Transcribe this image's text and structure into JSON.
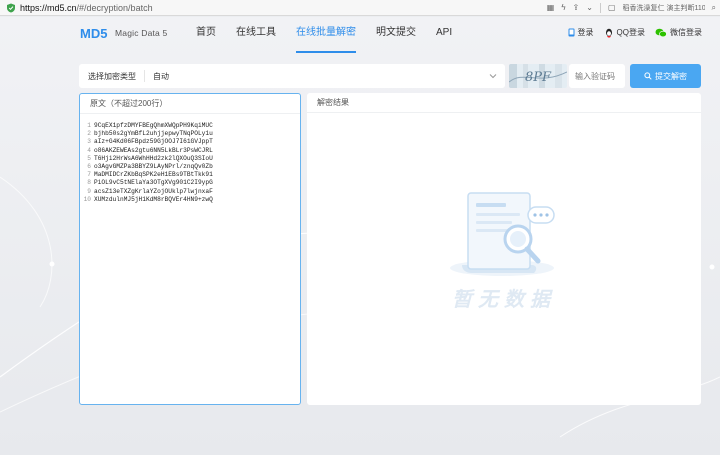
{
  "browser": {
    "url_host": "https://md5.cn",
    "url_path": "/#/decryption/batch",
    "hot_search": "稻香洗澡复仁 演主判断110万"
  },
  "nav": {
    "logo_mark": "MD5",
    "logo_text": "Magic Data 5",
    "menu": [
      {
        "label": "首页",
        "active": false
      },
      {
        "label": "在线工具",
        "active": false
      },
      {
        "label": "在线批量解密",
        "active": true
      },
      {
        "label": "明文提交",
        "active": false
      },
      {
        "label": "API",
        "active": false
      }
    ],
    "login": "登录",
    "qq_login": "QQ登录",
    "wechat_login": "微信登录"
  },
  "toolbar": {
    "type_label": "选择加密类型",
    "type_value": "自动",
    "captcha_placeholder": "输入验证码",
    "captcha_text": "8PF",
    "submit_label": "提交解密"
  },
  "source": {
    "title": "原文（不超过200行）",
    "lines": [
      {
        "n": "1",
        "t": "9CqEX1pfzDMYFBEgQhmXWQpPH9KqiMUC"
      },
      {
        "n": "2",
        "t": "bjhb50s2gYmBfL2uhjjepwyTNqPOLy1u"
      },
      {
        "n": "3",
        "t": "aIz+G4Kd06FBpdz59GjOOJ7I61GVJppT"
      },
      {
        "n": "4",
        "t": "o86AKZEWEAs2gtu6NN5LkBLr3PsWCJRL"
      },
      {
        "n": "5",
        "t": "T6Hji2HrWsA6WhHHd2zk2lQXOuQ3SIoU"
      },
      {
        "n": "6",
        "t": "o3AgvGMZPa3BBYZ9LAyNPrl/znqQv0Zb"
      },
      {
        "n": "7",
        "t": "MaDMIDCrZKbBqSPK2eH1EBs9TBtTkk91"
      },
      {
        "n": "8",
        "t": "PiOL9vC5tNElaYa3OTgXVg901C2I9ypG"
      },
      {
        "n": "9",
        "t": "acsZ13eTXZgKrlaYZojOUklp7lwjnxaF"
      },
      {
        "n": "10",
        "t": "XUMzdulnMJ5jH1KdM8rBQVEr4HN9+zwQ"
      }
    ]
  },
  "result": {
    "title": "解密结果",
    "empty_text": "暂无数据"
  },
  "colors": {
    "accent": "#2e8dea",
    "button": "#4aa7f2",
    "panel_border": "#67b3ef"
  }
}
